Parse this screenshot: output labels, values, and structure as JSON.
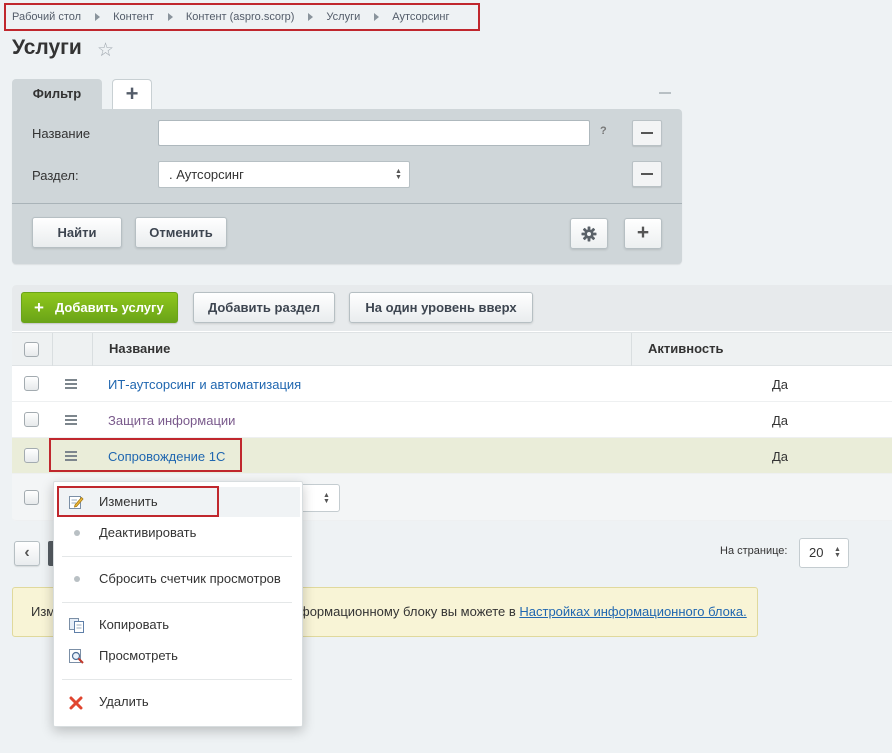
{
  "breadcrumb": [
    "Рабочий стол",
    "Контент",
    "Контент (aspro.scorp)",
    "Услуги",
    "Аутсорсинг"
  ],
  "page_title": "Услуги",
  "filter": {
    "tab_label": "Фильтр",
    "add_tab_label": "+",
    "name_label": "Название",
    "name_value": "",
    "help": "?",
    "section_label": "Раздел:",
    "section_value": ". Аутсорсинг",
    "find_button": "Найти",
    "cancel_button": "Отменить",
    "add_button": "+"
  },
  "toolbar": {
    "add_service": "Добавить услугу",
    "add_section": "Добавить раздел",
    "level_up": "На один уровень вверх"
  },
  "table": {
    "columns": [
      "Название",
      "Активность"
    ],
    "rows": [
      {
        "name": "ИТ-аутсорсинг и автоматизация",
        "active": "Да"
      },
      {
        "name": "Защита информации",
        "active": "Да"
      },
      {
        "name": "Сопровождение 1С",
        "active": "Да"
      }
    ]
  },
  "context_menu": {
    "items": [
      "Изменить",
      "Деактивировать",
      "Сбросить счетчик просмотров",
      "Копировать",
      "Просмотреть",
      "Удалить"
    ]
  },
  "pagination": {
    "prev": "‹",
    "per_page_label": "На странице:",
    "per_page_value": "20"
  },
  "note": {
    "prefix": "Изм",
    "text": "формационному блоку вы можете в",
    "link": "Настройках информационного блока."
  },
  "colors": {
    "accent_green": "#7ab51d",
    "highlight_row": "#eaedd9",
    "link_blue": "#2067b0",
    "annotation_red": "#c0272d"
  }
}
